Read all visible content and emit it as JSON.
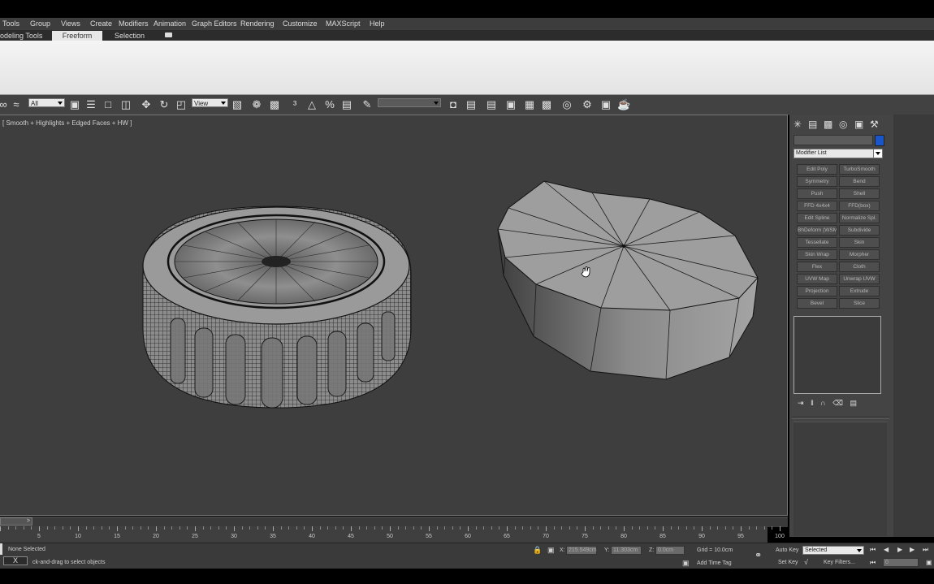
{
  "menu": [
    "Tools",
    "Group",
    "Views",
    "Create",
    "Modifiers",
    "Animation",
    "Graph Editors",
    "Rendering",
    "Customize",
    "MAXScript",
    "Help"
  ],
  "ribbon_tabs": {
    "modeling": "odeling Tools",
    "freeform": "Freeform",
    "selection": "Selection"
  },
  "toolbar": {
    "filter_select": "All",
    "ref_coord_select": "View"
  },
  "viewport": {
    "label": "[ Smooth + Highlights + Edged Faces + HW ]"
  },
  "command_panel": {
    "modifier_list_label": "Modifier List",
    "accent_color": "#1a56c8",
    "modifier_buttons": [
      "Edit Poly",
      "TurboSmooth",
      "Symmetry",
      "Bend",
      "Push",
      "Shell",
      "FFD 4x4x4",
      "FFD(box)",
      "Edit Spline",
      "Normalize Spl.",
      "BhDeform (WSM)",
      "Subdivide",
      "Tessellate",
      "Skin",
      "Skin Wrap",
      "Morpher",
      "Flex",
      "Cloth",
      "UVW Map",
      "Unwrap UVW",
      "Projection",
      "Extrude",
      "Bevel",
      "Slice"
    ]
  },
  "timeline": {
    "slider_label": ">",
    "tick_labels": [
      "5",
      "10",
      "15",
      "20",
      "25",
      "30",
      "35",
      "40",
      "45",
      "50",
      "55",
      "60",
      "65",
      "70",
      "75",
      "80",
      "85",
      "90",
      "95",
      "100"
    ]
  },
  "status": {
    "selection": "None Selected",
    "prompt": "ck-and-drag to select objects",
    "close_label": "X",
    "x_label": "X:",
    "x_value": "215.549cm",
    "y_label": "Y:",
    "y_value": "11.303cm",
    "z_label": "Z:",
    "z_value": "0.0cm",
    "grid": "Grid = 10.0cm",
    "add_time_tag": "Add Time Tag",
    "auto_key": "Auto Key",
    "key_mode": "Selected",
    "set_key": "Set Key",
    "key_filters": "Key Filters...",
    "frame_value": "0"
  }
}
